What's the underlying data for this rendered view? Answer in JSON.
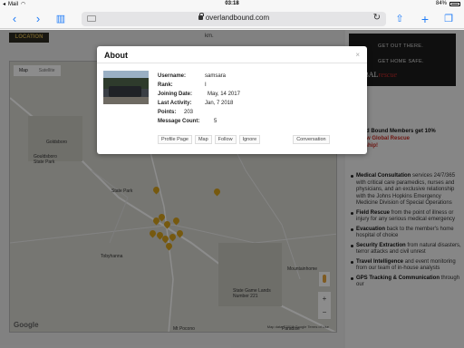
{
  "status_bar": {
    "carrier": "Mail",
    "time": "03:18",
    "battery_text": "84%"
  },
  "browser": {
    "url": "overlandbound.com"
  },
  "page": {
    "location_badge": "LOCATION",
    "top_text": "km.",
    "map": {
      "tabs": [
        "Map",
        "Satellite"
      ],
      "labels": [
        {
          "text": "Goldsboro"
        },
        {
          "text": "Gouldsboro State Park"
        },
        {
          "text": "State Park"
        },
        {
          "text": "Tobyhanna"
        },
        {
          "text": "Mountainhome"
        },
        {
          "text": "State Game Lands Number 221"
        },
        {
          "text": "Mt Pocono"
        },
        {
          "text": "Paradise"
        }
      ],
      "zoom_in": "+",
      "zoom_out": "−",
      "logo": "Google",
      "footer": "Map data ©2018 Google   Terms of Use"
    },
    "ad": {
      "line1": "GET OUT THERE.",
      "line2": "GET HOME SAFE.",
      "brand_main": "GLOBAL",
      "brand_accent": "rescue"
    },
    "promo": {
      "text": "and Bound Members get 10%",
      "text2": "new Global Rescue",
      "text3": "ership!"
    },
    "bullets": [
      {
        "title": "Medical Consultation",
        "text": " services 24/7/365 with critical care paramedics, nurses and physicians, and an exclusive relationship with the Johns Hopkins Emergency Medicine Division of Special Operations"
      },
      {
        "title": "Field Rescue",
        "text": " from the point of illness or injury for any serious medical emergency"
      },
      {
        "title": "Evacuation",
        "text": " back to the member's home hospital of choice"
      },
      {
        "title": "Security Extraction",
        "text": " from natural disasters, terror attacks and civil unrest"
      },
      {
        "title": "Travel Intelligence",
        "text": " and event monitoring from our team of in-house analysts"
      },
      {
        "title": "GPS Tracking & Communication",
        "text": " through our"
      }
    ]
  },
  "modal": {
    "title": "About",
    "close": "×",
    "fields": [
      {
        "label": "Username:",
        "value": "samsara"
      },
      {
        "label": "Rank:",
        "value": "I"
      },
      {
        "label": "Joining Date:",
        "value": "May, 14 2017"
      },
      {
        "label": "Last Activity:",
        "value": "Jan, 7 2018"
      },
      {
        "label": "Points:",
        "value": "203"
      },
      {
        "label": "Message Count:",
        "value": "5"
      }
    ],
    "actions": [
      "Profile Page",
      "Map",
      "Follow",
      "Ignore"
    ],
    "conversation": "Conversation"
  }
}
